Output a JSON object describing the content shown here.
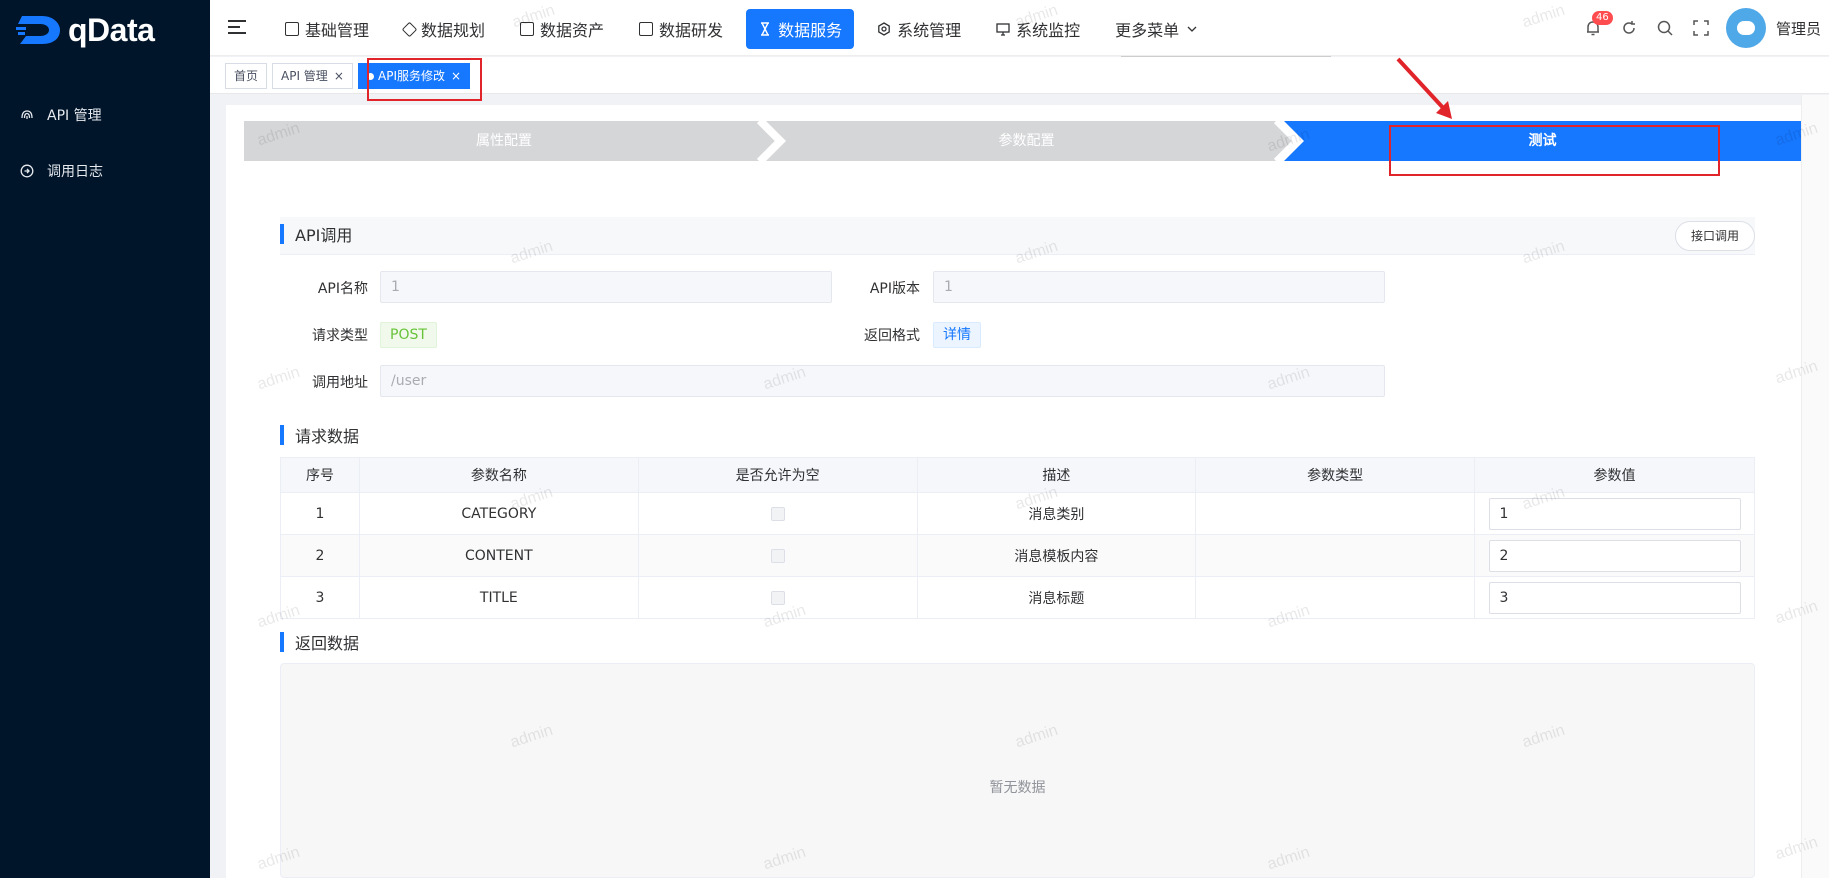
{
  "app": {
    "logo_text": "qData"
  },
  "sidebar": {
    "items": [
      {
        "label": "API 管理",
        "icon": "fingerprint-icon"
      },
      {
        "label": "调用日志",
        "icon": "circle-arrow-icon"
      }
    ]
  },
  "header": {
    "nav": [
      {
        "label": "基础管理",
        "icon": "building-icon",
        "active": false
      },
      {
        "label": "数据规划",
        "icon": "layers-icon",
        "active": false
      },
      {
        "label": "数据资产",
        "icon": "chart-doc-icon",
        "active": false
      },
      {
        "label": "数据研发",
        "icon": "window-icon",
        "active": false
      },
      {
        "label": "数据服务",
        "icon": "hourglass-icon",
        "active": true
      },
      {
        "label": "系统管理",
        "icon": "hexagon-gear-icon",
        "active": false
      },
      {
        "label": "系统监控",
        "icon": "monitor-icon",
        "active": false
      },
      {
        "label": "更多菜单",
        "icon": "chevron-down-icon",
        "active": false
      }
    ],
    "notification_count": "46",
    "user_name": "管理员"
  },
  "tags": [
    {
      "label": "首页",
      "closable": false,
      "active": false
    },
    {
      "label": "API 管理",
      "closable": true,
      "active": false
    },
    {
      "label": "API服务修改",
      "closable": true,
      "active": true
    }
  ],
  "steps": [
    {
      "label": "属性配置",
      "active": false
    },
    {
      "label": "参数配置",
      "active": false
    },
    {
      "label": "测试",
      "active": true
    }
  ],
  "api_call": {
    "section_title": "API调用",
    "call_button": "接口调用",
    "fields": {
      "api_name_label": "API名称",
      "api_name_value": "1",
      "api_version_label": "API版本",
      "api_version_value": "1",
      "request_type_label": "请求类型",
      "request_type_value": "POST",
      "return_format_label": "返回格式",
      "return_format_value": "详情",
      "call_url_label": "调用地址",
      "call_url_value": "/user"
    }
  },
  "request_data": {
    "section_title": "请求数据",
    "columns": [
      "序号",
      "参数名称",
      "是否允许为空",
      "描述",
      "参数类型",
      "参数值"
    ],
    "rows": [
      {
        "index": "1",
        "name": "CATEGORY",
        "nullable": false,
        "desc": "消息类别",
        "type": "",
        "value": "1"
      },
      {
        "index": "2",
        "name": "CONTENT",
        "nullable": false,
        "desc": "消息模板内容",
        "type": "",
        "value": "2"
      },
      {
        "index": "3",
        "name": "TITLE",
        "nullable": false,
        "desc": "消息标题",
        "type": "",
        "value": "3"
      }
    ]
  },
  "return_data": {
    "section_title": "返回数据",
    "empty_text": "暂无数据"
  },
  "watermark": "admin",
  "colors": {
    "sidebar_bg": "#001529",
    "primary": "#1677ff",
    "highlight_red": "#e0242a"
  }
}
